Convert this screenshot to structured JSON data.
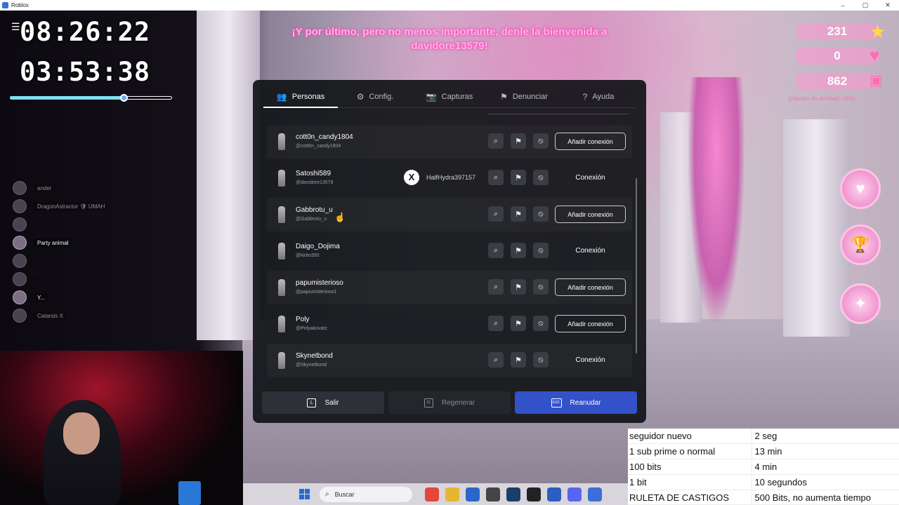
{
  "window": {
    "title": "Roblox",
    "controls": [
      "–",
      "▢",
      "✕"
    ]
  },
  "overlay": {
    "timer_top": "08:26:22",
    "timer_bottom": "03:53:38",
    "progress_fraction": 0.7,
    "players": [
      {
        "name": "ander",
        "dim": true
      },
      {
        "name": "DragonAstractor  🛡 UMAH",
        "dim": true
      },
      {
        "name": "",
        "dim": true
      },
      {
        "name": "Party animal",
        "dim": false
      },
      {
        "name": "",
        "dim": true
      },
      {
        "name": "",
        "dim": true
      },
      {
        "name": "Y...",
        "dim": false
      },
      {
        "name": "Catarsis X",
        "dim": true
      }
    ]
  },
  "announcement": "¡Y por último, pero no menos importante, denle la bienvenida a davidore13579!",
  "hud": {
    "values": [
      "231",
      "0",
      "862"
    ],
    "note": "(impulso de amistad: +5%)"
  },
  "dialog": {
    "tabs": [
      {
        "icon": "people-icon",
        "glyph": "👥",
        "label": "Personas",
        "active": true
      },
      {
        "icon": "gear-icon",
        "glyph": "⚙",
        "label": "Config.",
        "active": false
      },
      {
        "icon": "camera-icon",
        "glyph": "📷",
        "label": "Capturas",
        "active": false
      },
      {
        "icon": "report-icon",
        "glyph": "⚑",
        "label": "Denunciar",
        "active": false
      },
      {
        "icon": "help-icon",
        "glyph": "?",
        "label": "Ayuda",
        "active": false
      }
    ],
    "rows": [
      {
        "name": "cott0n_candy1804",
        "handle": "@cott0n_candy1804",
        "xbox": "",
        "action": "Añadir conexión",
        "action_style": "button"
      },
      {
        "name": "Satoshi589",
        "handle": "@davidore13579",
        "xbox": "HalfHydra397157",
        "action": "Conexión",
        "action_style": "plain"
      },
      {
        "name": "Gabbrotu_u",
        "handle": "@Gabbrotu_u",
        "xbox": "",
        "action": "Añadir conexión",
        "action_style": "button"
      },
      {
        "name": "Daigo_Dojima",
        "handle": "@kirito350",
        "xbox": "",
        "action": "Conexión",
        "action_style": "plain"
      },
      {
        "name": "papumisterioso",
        "handle": "@papumisterioso1",
        "xbox": "",
        "action": "Añadir conexión",
        "action_style": "button"
      },
      {
        "name": "Poly",
        "handle": "@Polyakovatz",
        "xbox": "",
        "action": "Añadir conexión",
        "action_style": "button"
      },
      {
        "name": "Skynetbond",
        "handle": "@Skynetbond",
        "xbox": "",
        "action": "Conexión",
        "action_style": "plain"
      }
    ],
    "row_icons": {
      "inspect": "zoom-icon",
      "report": "report-icon",
      "block": "block-icon"
    },
    "footer": {
      "leave": {
        "key": "L",
        "label": "Salir"
      },
      "reset": {
        "key": "R",
        "label": "Regenerar"
      },
      "resume": {
        "key": "ESC",
        "label": "Reanudar"
      }
    }
  },
  "taskbar": {
    "search_placeholder": "Buscar",
    "apps": [
      {
        "icon": "chrome-icon",
        "color": "#e5453b"
      },
      {
        "icon": "folder-icon",
        "color": "#e8b531"
      },
      {
        "icon": "store-icon",
        "color": "#2b67c9"
      },
      {
        "icon": "app-icon",
        "color": "#444444"
      },
      {
        "icon": "steam-icon",
        "color": "#1b3d6b"
      },
      {
        "icon": "epic-icon",
        "color": "#222222"
      },
      {
        "icon": "word-icon",
        "color": "#2b5fbf"
      },
      {
        "icon": "discord-icon",
        "color": "#5865f2"
      },
      {
        "icon": "roblox-icon",
        "color": "#3a6fd8"
      }
    ]
  },
  "rules_table": [
    [
      "seguidor nuevo",
      "2 seg"
    ],
    [
      "1 sub prime o normal",
      "13 min"
    ],
    [
      "100 bits",
      "4 min"
    ],
    [
      "1 bit",
      "10 segundos"
    ],
    [
      "RULETA DE CASTIGOS",
      "500 Bits, no aumenta tiempo"
    ]
  ],
  "colors": {
    "accent": "#3352c9",
    "progress": "#7fe0ef",
    "announcement": "#ffb3e8"
  }
}
